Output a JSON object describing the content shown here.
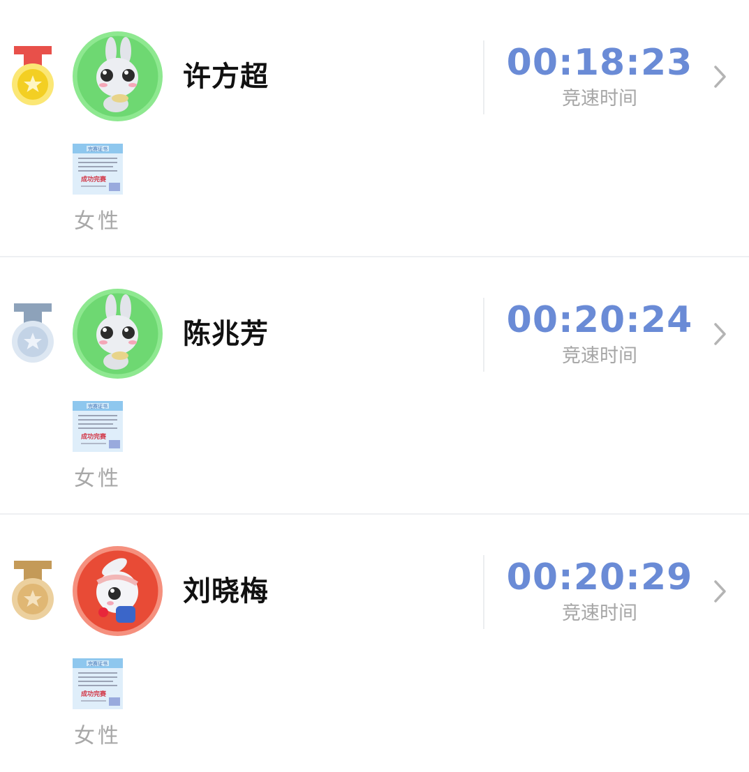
{
  "entries": [
    {
      "rank": 1,
      "medal": "gold",
      "name": "许方超",
      "time": "00:18:23",
      "time_label": "竞速时间",
      "gender": "女性",
      "avatar": "bunny-eating-avatar",
      "avatar_bg": "#8ee890"
    },
    {
      "rank": 2,
      "medal": "silver",
      "name": "陈兆芳",
      "time": "00:20:24",
      "time_label": "竞速时间",
      "gender": "女性",
      "avatar": "bunny-eating-avatar",
      "avatar_bg": "#8ee890"
    },
    {
      "rank": 3,
      "medal": "bronze",
      "name": "刘晓梅",
      "time": "00:20:29",
      "time_label": "竞速时间",
      "gender": "女性",
      "avatar": "bunny-runner-avatar",
      "avatar_bg": "#f5907e"
    }
  ],
  "colors": {
    "time": "#6a8bd6",
    "gold": "#f5d742",
    "gold_ribbon": "#e8504a",
    "silver": "#c3d3e6",
    "silver_ribbon": "#8da2ba",
    "bronze": "#e0b774",
    "bronze_ribbon": "#c49a58"
  },
  "certificate_text": {
    "title": "完赛证书",
    "stamp": "成功完赛"
  }
}
